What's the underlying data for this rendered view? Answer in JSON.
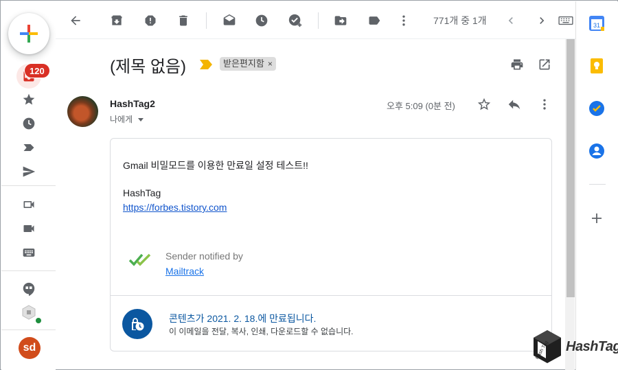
{
  "left_rail": {
    "badge_count": "120",
    "profile_initials": "sd",
    "items": [
      {
        "icon": "inbox-icon"
      },
      {
        "icon": "star-icon"
      },
      {
        "icon": "clock-icon"
      },
      {
        "icon": "label-icon"
      },
      {
        "icon": "send-icon"
      },
      {
        "icon": "meet-new-icon"
      },
      {
        "icon": "meet-join-icon"
      },
      {
        "icon": "keyboard-icon"
      },
      {
        "icon": "hangouts-icon"
      },
      {
        "icon": "hangouts-contact-icon"
      }
    ],
    "colors": {
      "badge": "#d93025",
      "profile": "#d14c1b",
      "online": "#1e8e3e"
    }
  },
  "toolbar": {
    "pager_text": "771개 중 1개",
    "icons": [
      "back-icon",
      "archive-icon",
      "report-spam-icon",
      "delete-icon",
      "mark-unread-icon",
      "snooze-icon",
      "add-task-icon",
      "move-to-icon",
      "labels-icon",
      "more-icon",
      "newer-icon",
      "older-icon",
      "input-tools-icon"
    ]
  },
  "message": {
    "subject": "(제목 없음)",
    "label": "받은편지함",
    "label_close": "×",
    "sender_name": "HashTag2",
    "to_line": "나에게",
    "timestamp": "오후 5:09 (0분 전)",
    "body_line1": "Gmail 비밀모드를 이용한 만료일 설정 테스트!!",
    "body_line2": "HashTag",
    "body_link": "https://forbes.tistory.com",
    "mailtrack_text": "Sender notified by",
    "mailtrack_link": "Mailtrack",
    "expiry_title": "콘텐츠가 2021. 2. 18.에 만료됩니다.",
    "expiry_subtitle": "이 이메일을 전달, 복사, 인쇄, 다운로드할 수 없습니다."
  },
  "side_panel": {
    "apps": [
      "calendar-icon",
      "keep-icon",
      "tasks-icon",
      "contacts-icon",
      "add-addon-icon"
    ],
    "calendar_day": "31"
  },
  "watermark": {
    "text": "HashTag",
    "cube_text": "Hash Tag"
  },
  "colors": {
    "accent_blue": "#0b57a0",
    "link": "#1155cc",
    "mailtrack_green": "#4caf50",
    "importance": "#f4b400"
  }
}
